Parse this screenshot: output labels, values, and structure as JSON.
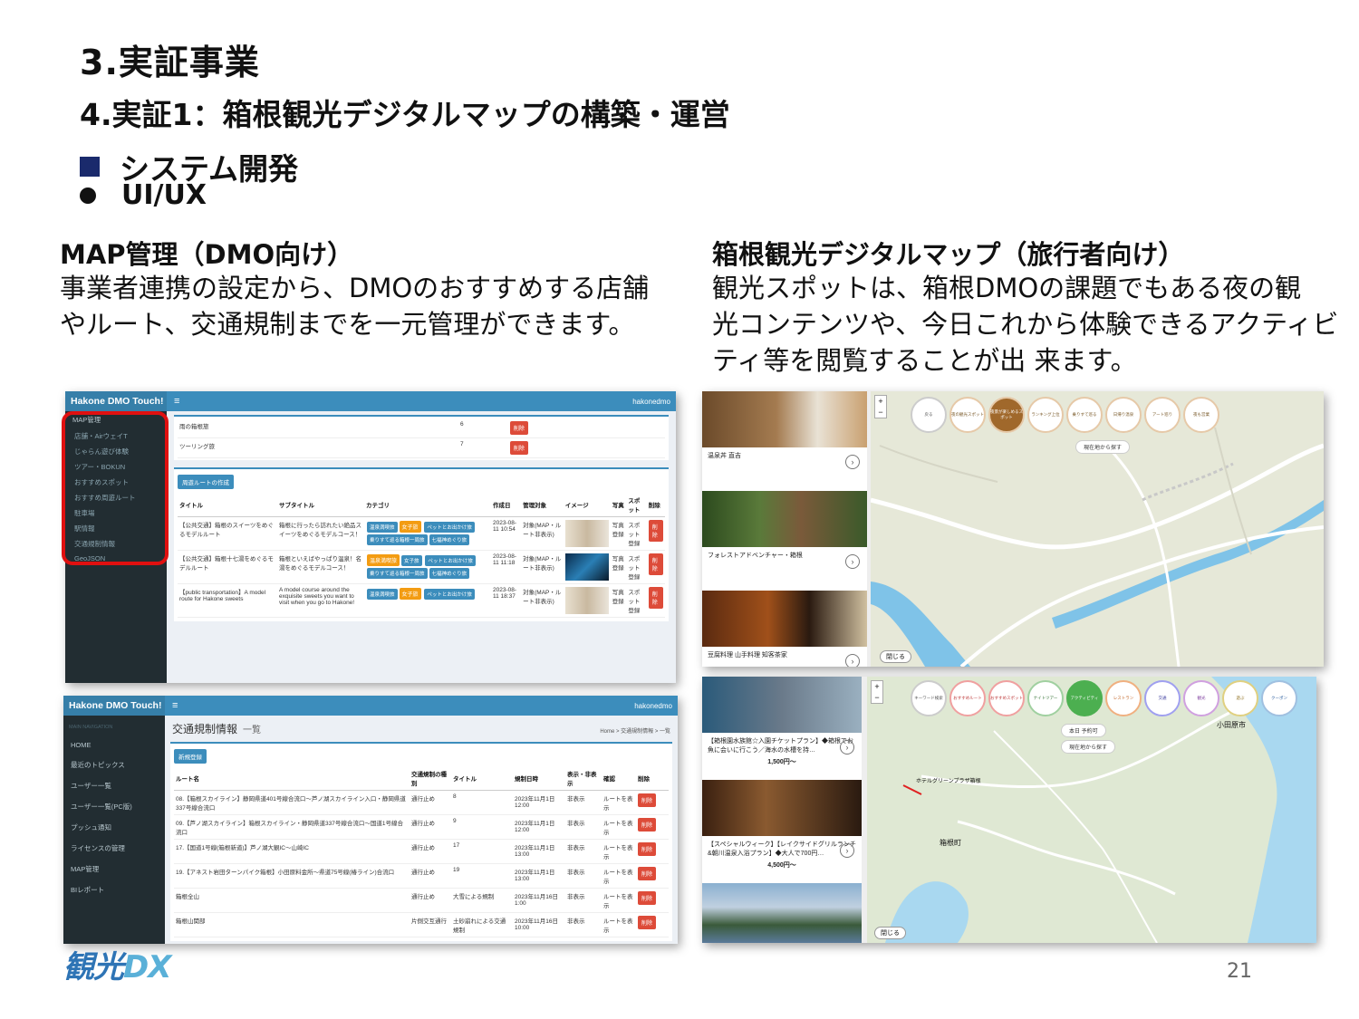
{
  "header": {
    "section": "3.実証事業",
    "subsection": "4.実証1：箱根観光デジタルマップの構築・運営",
    "bullet1": "システム開発",
    "bullet2": "UI/UX"
  },
  "left_col": {
    "title": "MAP管理（DMO向け）",
    "body_line1": "事業者連携の設定から、DMOのおすすめする店舗",
    "body_line2": "やルート、交通規制までを一元管理ができます。"
  },
  "right_col": {
    "title": "箱根観光デジタルマップ（旅行者向け）",
    "body_line1": "観光スポットは、箱根DMOの課題でもある夜の観",
    "body_line2": "光コンテンツや、今日これから体験できるアクティビ",
    "body_line3": "ティ等を閲覧することが出 来ます。"
  },
  "admin1": {
    "brand": "Hakone DMO Touch!",
    "menu_icon": "≡",
    "user": "hakonedmo",
    "sidebar": [
      "MAP管理",
      "店舗・AirウェイT",
      "じゃらん遊び体験",
      "ツアー・BOKUN",
      "おすすめスポット",
      "おすすめ周遊ルート",
      "駐車場",
      "駅情報",
      "交通規制情報",
      "GeoJSON"
    ],
    "top_rows": [
      {
        "name": "雨の箱根旅",
        "num": "6"
      },
      {
        "name": "ツーリング旅",
        "num": "7"
      }
    ],
    "create_btn": "周遊ルートの作成",
    "delete": "削除",
    "columns": [
      "タイトル",
      "サブタイトル",
      "カテゴリ",
      "作成日",
      "管理対象",
      "イメージ",
      "写真",
      "スポット",
      "削除"
    ],
    "rows": [
      {
        "title": "【公共交通】箱根のスイーツをめぐるモデルルート",
        "sub": "箱根に行ったら訪れたい絶品スイーツをめぐるモデルコース！",
        "date": "2023-08-11 10:54",
        "target": "対象(MAP・ルート非表示)",
        "photo": "写真登録",
        "spot": "スポット登録"
      },
      {
        "title": "【公共交通】箱根十七湯をめぐるモデルルート",
        "sub": "箱根といえばやっぱり温泉！名湯をめぐるモデルコース！",
        "date": "2023-08-11 11:18",
        "target": "対象(MAP・ルート非表示)",
        "photo": "写真登録",
        "spot": "スポット登録"
      },
      {
        "title": "【public transportation】A model route for Hakone sweets",
        "sub": "A model course around the exquisite sweets you want to visit when you go to Hakone!",
        "date": "2023-08-11 18:37",
        "target": "対象(MAP・ルート非表示)",
        "photo": "写真登録",
        "spot": "スポット登録"
      }
    ],
    "tags": [
      "温泉満喫旅",
      "女子旅",
      "ペットとお出かけ旅",
      "乗りすて巡る箱根一周旅",
      "七福神めぐり旅",
      "雨の箱根旅",
      "ツーリング旅"
    ]
  },
  "admin2": {
    "brand": "Hakone DMO Touch!",
    "menu_icon": "≡",
    "user": "hakonedmo",
    "nav_header": "MAIN NAVIGATION",
    "sidebar": [
      "HOME",
      "最近のトピックス",
      "ユーザー一覧",
      "ユーザー一覧(PC版)",
      "プッシュ通知",
      "ライセンスの管理",
      "MAP管理",
      "BIレポート"
    ],
    "page_title": "交通規制情報",
    "page_sub": "一覧",
    "crumb": "Home > 交通規制情報 > 一覧",
    "new_btn": "新規登録",
    "columns": [
      "ルート名",
      "交通規制の種別",
      "タイトル",
      "規制日時",
      "表示・非表示",
      "確認",
      "削除"
    ],
    "rows": [
      {
        "route": "08.【箱根スカイライン】静岡県道401号線合流口〜芦ノ湖スカイライン入口・静岡県道337号線合流口",
        "type": "通行止め",
        "title": "8",
        "date": "2023年11月1日 12:00",
        "vis": "非表示",
        "check": "ルートを表示"
      },
      {
        "route": "09.【芦ノ湖スカイライン】箱根スカイライン・静岡県道337号線合流口〜国道1号線合流口",
        "type": "通行止め",
        "title": "9",
        "date": "2023年11月1日 12:00",
        "vis": "非表示",
        "check": "ルートを表示"
      },
      {
        "route": "17.【国道1号線(箱根新道)】芦ノ湖大観IC〜山崎IC",
        "type": "通行止め",
        "title": "17",
        "date": "2023年11月1日 13:00",
        "vis": "非表示",
        "check": "ルートを表示"
      },
      {
        "route": "19.【アネスト岩田ターンパイク箱根】小田原料金所〜県道75号線(椿ライン)合流口",
        "type": "通行止め",
        "title": "19",
        "date": "2023年11月1日 13:00",
        "vis": "非表示",
        "check": "ルートを表示"
      },
      {
        "route": "箱根全山",
        "type": "通行止め",
        "title": "大雪による規制",
        "date": "2023年11月16日 1:00",
        "vis": "非表示",
        "check": "ルートを表示"
      },
      {
        "route": "箱根山関部",
        "type": "片側交互通行",
        "title": "土砂崩れによる交通規制",
        "date": "2023年11月16日 10:00",
        "vis": "非表示",
        "check": "ルートを表示"
      }
    ],
    "delete": "削除"
  },
  "map1": {
    "cards": [
      "温泉丼 直吉",
      "フォレストアドベンチャー・箱根",
      "豆腐料理 山手料理 知客茶家"
    ],
    "cats": [
      "戻る",
      "夜の観光スポット",
      "夜景が楽しめるスポット",
      "ランキング上位",
      "乗りすて巡る",
      "日帰り温泉",
      "アート巡り",
      "夜も営業"
    ],
    "locate": "現在地から探す",
    "close": "閉じる"
  },
  "map2": {
    "cards": [
      {
        "title": "【箱根園水族館☆入園チケットプラン】◆箱根でお魚に会いに行こう／海水の水槽を持…",
        "price": "1,500円〜"
      },
      {
        "title": "【スペシャルウィーク】【レイクサイドグリルランチ&朝川温泉入浴プラン】◆大人で700円…",
        "price": "4,500円〜"
      }
    ],
    "cats": [
      "キーワード検索",
      "おすすめルート",
      "おすすめスポット",
      "ナイトツアー",
      "アクティビティ",
      "レストラン",
      "交通",
      "観光",
      "遊ぶ",
      "クーポン"
    ],
    "date_pill": "本日 予約可",
    "locate": "現在地から探す",
    "labels": [
      "小田原市",
      "箱根町",
      "ホテルグリーンプラザ箱根"
    ],
    "close": "閉じる"
  },
  "logo": {
    "main": "観光",
    "dx": "DX"
  },
  "page_number": "21"
}
